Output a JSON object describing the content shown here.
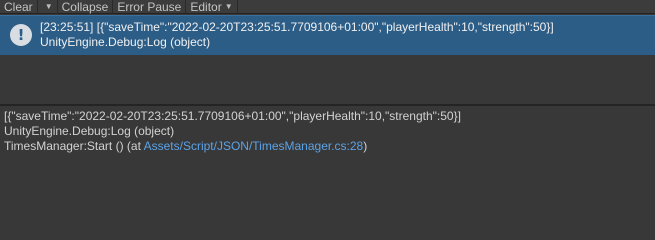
{
  "toolbar": {
    "clear_label": "Clear",
    "collapse_label": "Collapse",
    "error_pause_label": "Error Pause",
    "editor_label": "Editor"
  },
  "log_entry": {
    "icon": "info-icon",
    "timestamp": "[23:25:51]",
    "message": "[{\"saveTime\":\"2022-02-20T23:25:51.7709106+01:00\",\"playerHealth\":10,\"strength\":50}]",
    "source": "UnityEngine.Debug:Log (object)"
  },
  "detail": {
    "message": "[{\"saveTime\":\"2022-02-20T23:25:51.7709106+01:00\",\"playerHealth\":10,\"strength\":50}]",
    "stack_line1": "UnityEngine.Debug:Log (object)",
    "stack_line2_prefix": "TimesManager:Start () (at ",
    "stack_line2_link": "Assets/Script/JSON/TimesManager.cs:28",
    "stack_line2_suffix": ")"
  },
  "colors": {
    "selected_row": "#2c5d87",
    "link": "#5ca2e6",
    "background": "#383838"
  }
}
